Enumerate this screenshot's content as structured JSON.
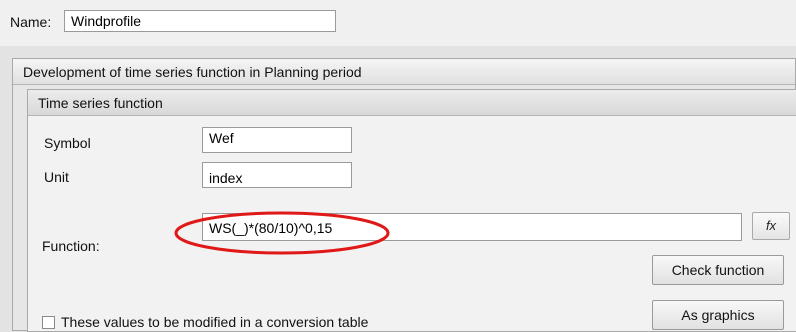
{
  "name_row": {
    "label": "Name:",
    "value": "Windprofile"
  },
  "outer_group": {
    "title": "Development of time series function in Planning period"
  },
  "inner_group": {
    "title": "Time series function",
    "symbol": {
      "label": "Symbol",
      "value": "Wef"
    },
    "unit": {
      "label": "Unit",
      "value": "index"
    },
    "function": {
      "label": "Function:",
      "value": "WS(_)*(80/10)^0,15"
    },
    "fx_button": "fx",
    "check_function_button": "Check function",
    "as_graphics_button": "As graphics",
    "conversion_checkbox": {
      "label": "These values to be modified in a conversion table",
      "checked": false
    }
  },
  "annotation": {
    "color": "#e01818"
  }
}
